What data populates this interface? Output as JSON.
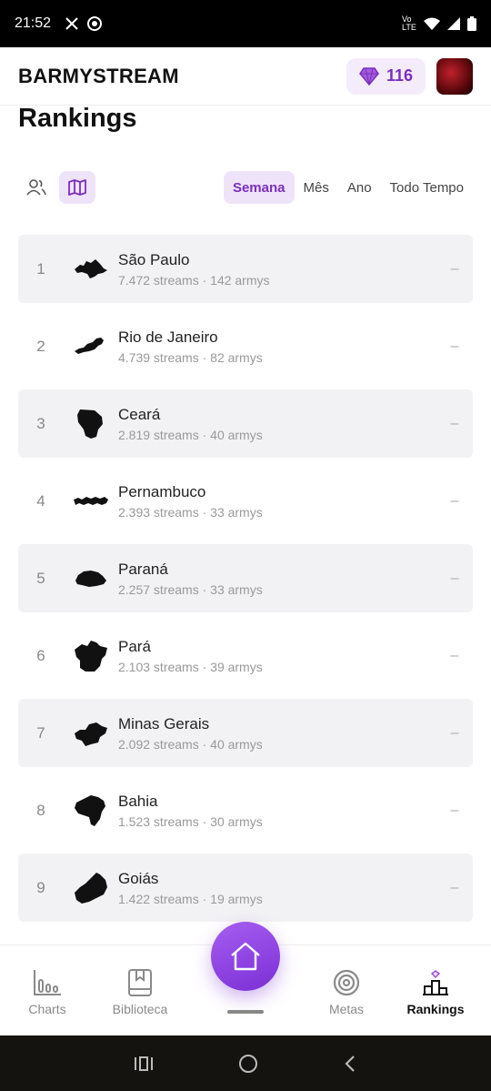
{
  "status_bar": {
    "time": "21:52",
    "network": "Vo LTE"
  },
  "app": {
    "title": "BARMYSTREAM",
    "gem_count": "116"
  },
  "page": {
    "title": "Rankings"
  },
  "filters": {
    "periods": [
      "Semana",
      "Mês",
      "Ano",
      "Todo Tempo"
    ],
    "active_period": "Semana",
    "active_view": "map"
  },
  "rankings": [
    {
      "rank": "1",
      "name": "São Paulo",
      "stats": "7.472 streams · 142 armys",
      "trend": "–"
    },
    {
      "rank": "2",
      "name": "Rio de Janeiro",
      "stats": "4.739 streams · 82 armys",
      "trend": "–"
    },
    {
      "rank": "3",
      "name": "Ceará",
      "stats": "2.819 streams · 40 armys",
      "trend": "–"
    },
    {
      "rank": "4",
      "name": "Pernambuco",
      "stats": "2.393 streams · 33 armys",
      "trend": "–"
    },
    {
      "rank": "5",
      "name": "Paraná",
      "stats": "2.257 streams · 33 armys",
      "trend": "–"
    },
    {
      "rank": "6",
      "name": "Pará",
      "stats": "2.103 streams · 39 armys",
      "trend": "–"
    },
    {
      "rank": "7",
      "name": "Minas Gerais",
      "stats": "2.092 streams · 40 armys",
      "trend": "–"
    },
    {
      "rank": "8",
      "name": "Bahia",
      "stats": "1.523 streams · 30 armys",
      "trend": "–"
    },
    {
      "rank": "9",
      "name": "Goiás",
      "stats": "1.422 streams · 19 armys",
      "trend": "–"
    }
  ],
  "bottom_nav": {
    "charts": "Charts",
    "library": "Biblioteca",
    "goals": "Metas",
    "rankings": "Rankings",
    "active": "Rankings"
  },
  "colors": {
    "accent": "#7b2fbe",
    "accent_light": "#efe3fa",
    "row_shade": "#f2f2f4"
  }
}
